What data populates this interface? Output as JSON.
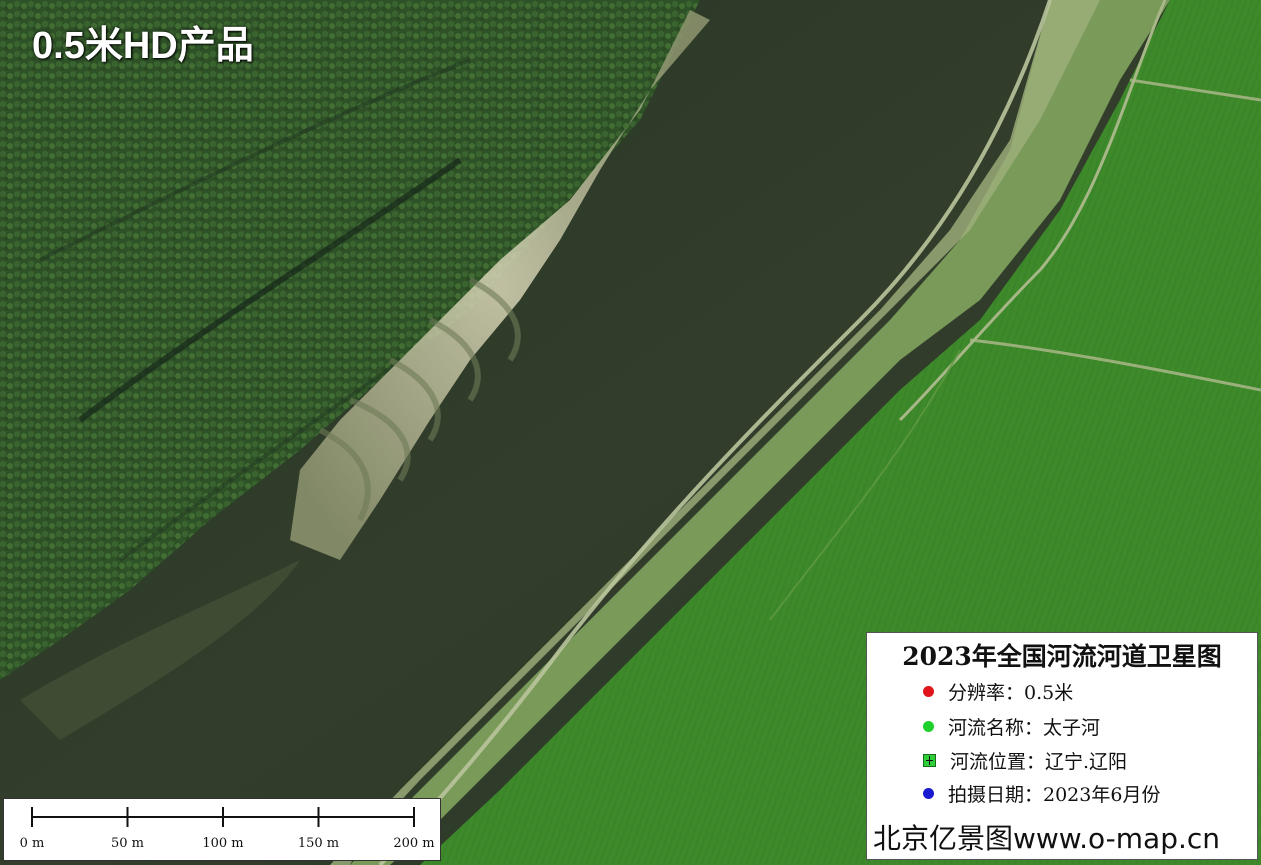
{
  "badge": "0.5米HD产品",
  "legend": {
    "title": "2023年全国河流河道卫星图",
    "items": [
      {
        "icon": "red-dot-icon",
        "color": "#e0141a",
        "text": "分辨率：0.5米"
      },
      {
        "icon": "green-dot-icon",
        "color": "#1fd02c",
        "text": "河流名称：太子河"
      },
      {
        "icon": "green-square-icon",
        "color": "#2fcf3a",
        "text": "河流位置：辽宁.辽阳"
      },
      {
        "icon": "blue-dot-icon",
        "color": "#1a1ad0",
        "text": "拍摄日期：2023年6月份"
      }
    ],
    "footer": "北京亿景图www.o-map.cn"
  },
  "scale": {
    "labels": [
      "0 m",
      "50 m",
      "100 m",
      "150 m",
      "200 m"
    ]
  }
}
